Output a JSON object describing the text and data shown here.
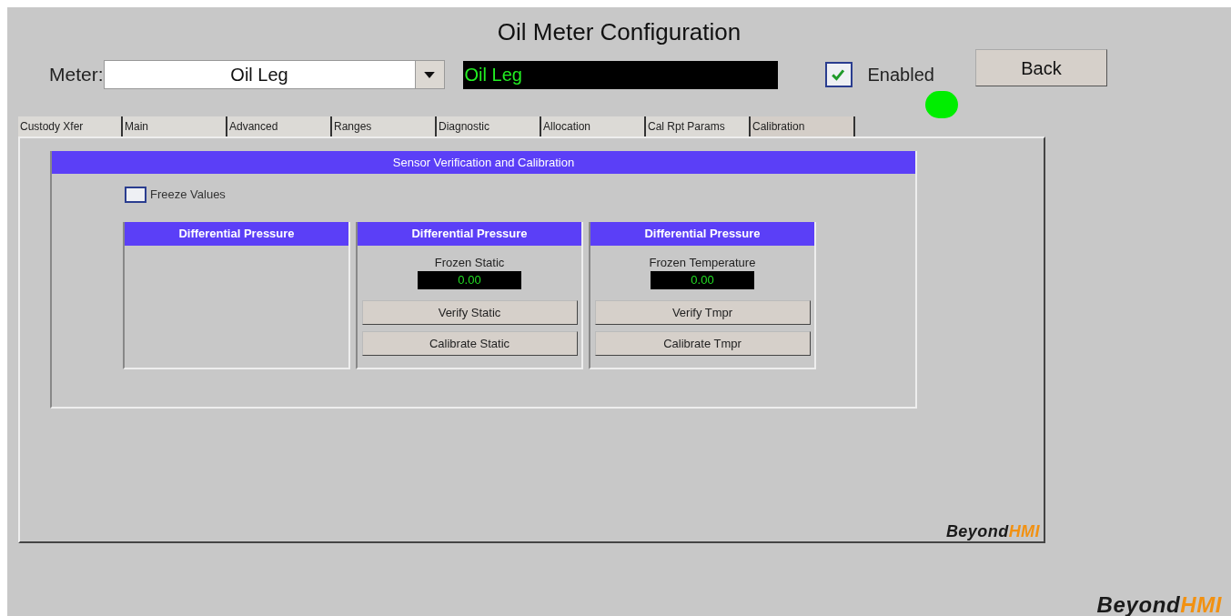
{
  "title": "Oil Meter Configuration",
  "meter": {
    "label": "Meter:",
    "value": "Oil Leg",
    "display": "Oil Leg"
  },
  "enabled": {
    "label": "Enabled",
    "checked": true
  },
  "status_indicator": {
    "on": true
  },
  "back_button": "Back",
  "tabs": [
    {
      "label": "Custody Xfer",
      "selected": false
    },
    {
      "label": "Main",
      "selected": false
    },
    {
      "label": "Advanced",
      "selected": false
    },
    {
      "label": "Ranges",
      "selected": false
    },
    {
      "label": "Diagnostic",
      "selected": false
    },
    {
      "label": "Allocation",
      "selected": false
    },
    {
      "label": "Cal Rpt Params",
      "selected": false
    },
    {
      "label": "Calibration",
      "selected": true
    }
  ],
  "section": {
    "title": "Sensor Verification and Calibration",
    "freeze": {
      "label": "Freeze Values",
      "checked": false
    },
    "panels": [
      {
        "title": "Differential Pressure"
      },
      {
        "title": "Differential Pressure",
        "reading_label": "Frozen Static",
        "reading": "0.00",
        "buttons": [
          "Verify Static",
          "Calibrate Static"
        ]
      },
      {
        "title": "Differential Pressure",
        "reading_label": "Frozen Temperature",
        "reading": "0.00",
        "buttons": [
          "Verify Tmpr",
          "Calibrate Tmpr"
        ]
      }
    ]
  },
  "logos": [
    {
      "left": "Beyond",
      "right": "HMI"
    },
    {
      "left": "Beyond",
      "right": "HMI"
    }
  ]
}
